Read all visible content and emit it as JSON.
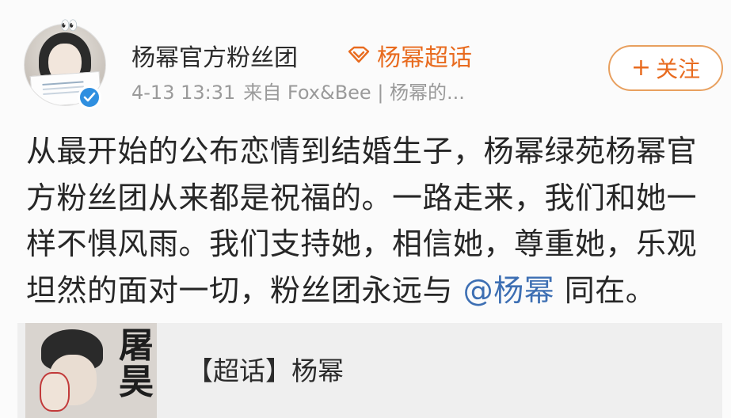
{
  "header": {
    "username": "杨幂官方粉丝团",
    "topic_icon": "diamond-icon",
    "topic_label": "杨幂超话",
    "timestamp": "4-13 13:31",
    "source": "来自 Fox&Bee | 杨幂的...",
    "follow_label": "关注",
    "follow_plus": "+",
    "verified_icon": "verified-check-icon",
    "accent_color": "#e86b1f",
    "verified_color": "#2f8fe0",
    "avatar_deco": "👀"
  },
  "post": {
    "text_before": "从最开始的公布恋情到结婚生子，杨幂绿苑杨幂官方粉丝团从来都是祝福的。一路走来，我们和她一样不惧风雨。我们支持她，相信她，尊重她，乐观坦然的面对一切，粉丝团永远与 ",
    "mention": "@杨幂",
    "text_after": " 同在。",
    "mention_color": "#3d6fb3"
  },
  "topic_card": {
    "title": "【超话】杨幂",
    "thumb_text": "屠昊"
  }
}
